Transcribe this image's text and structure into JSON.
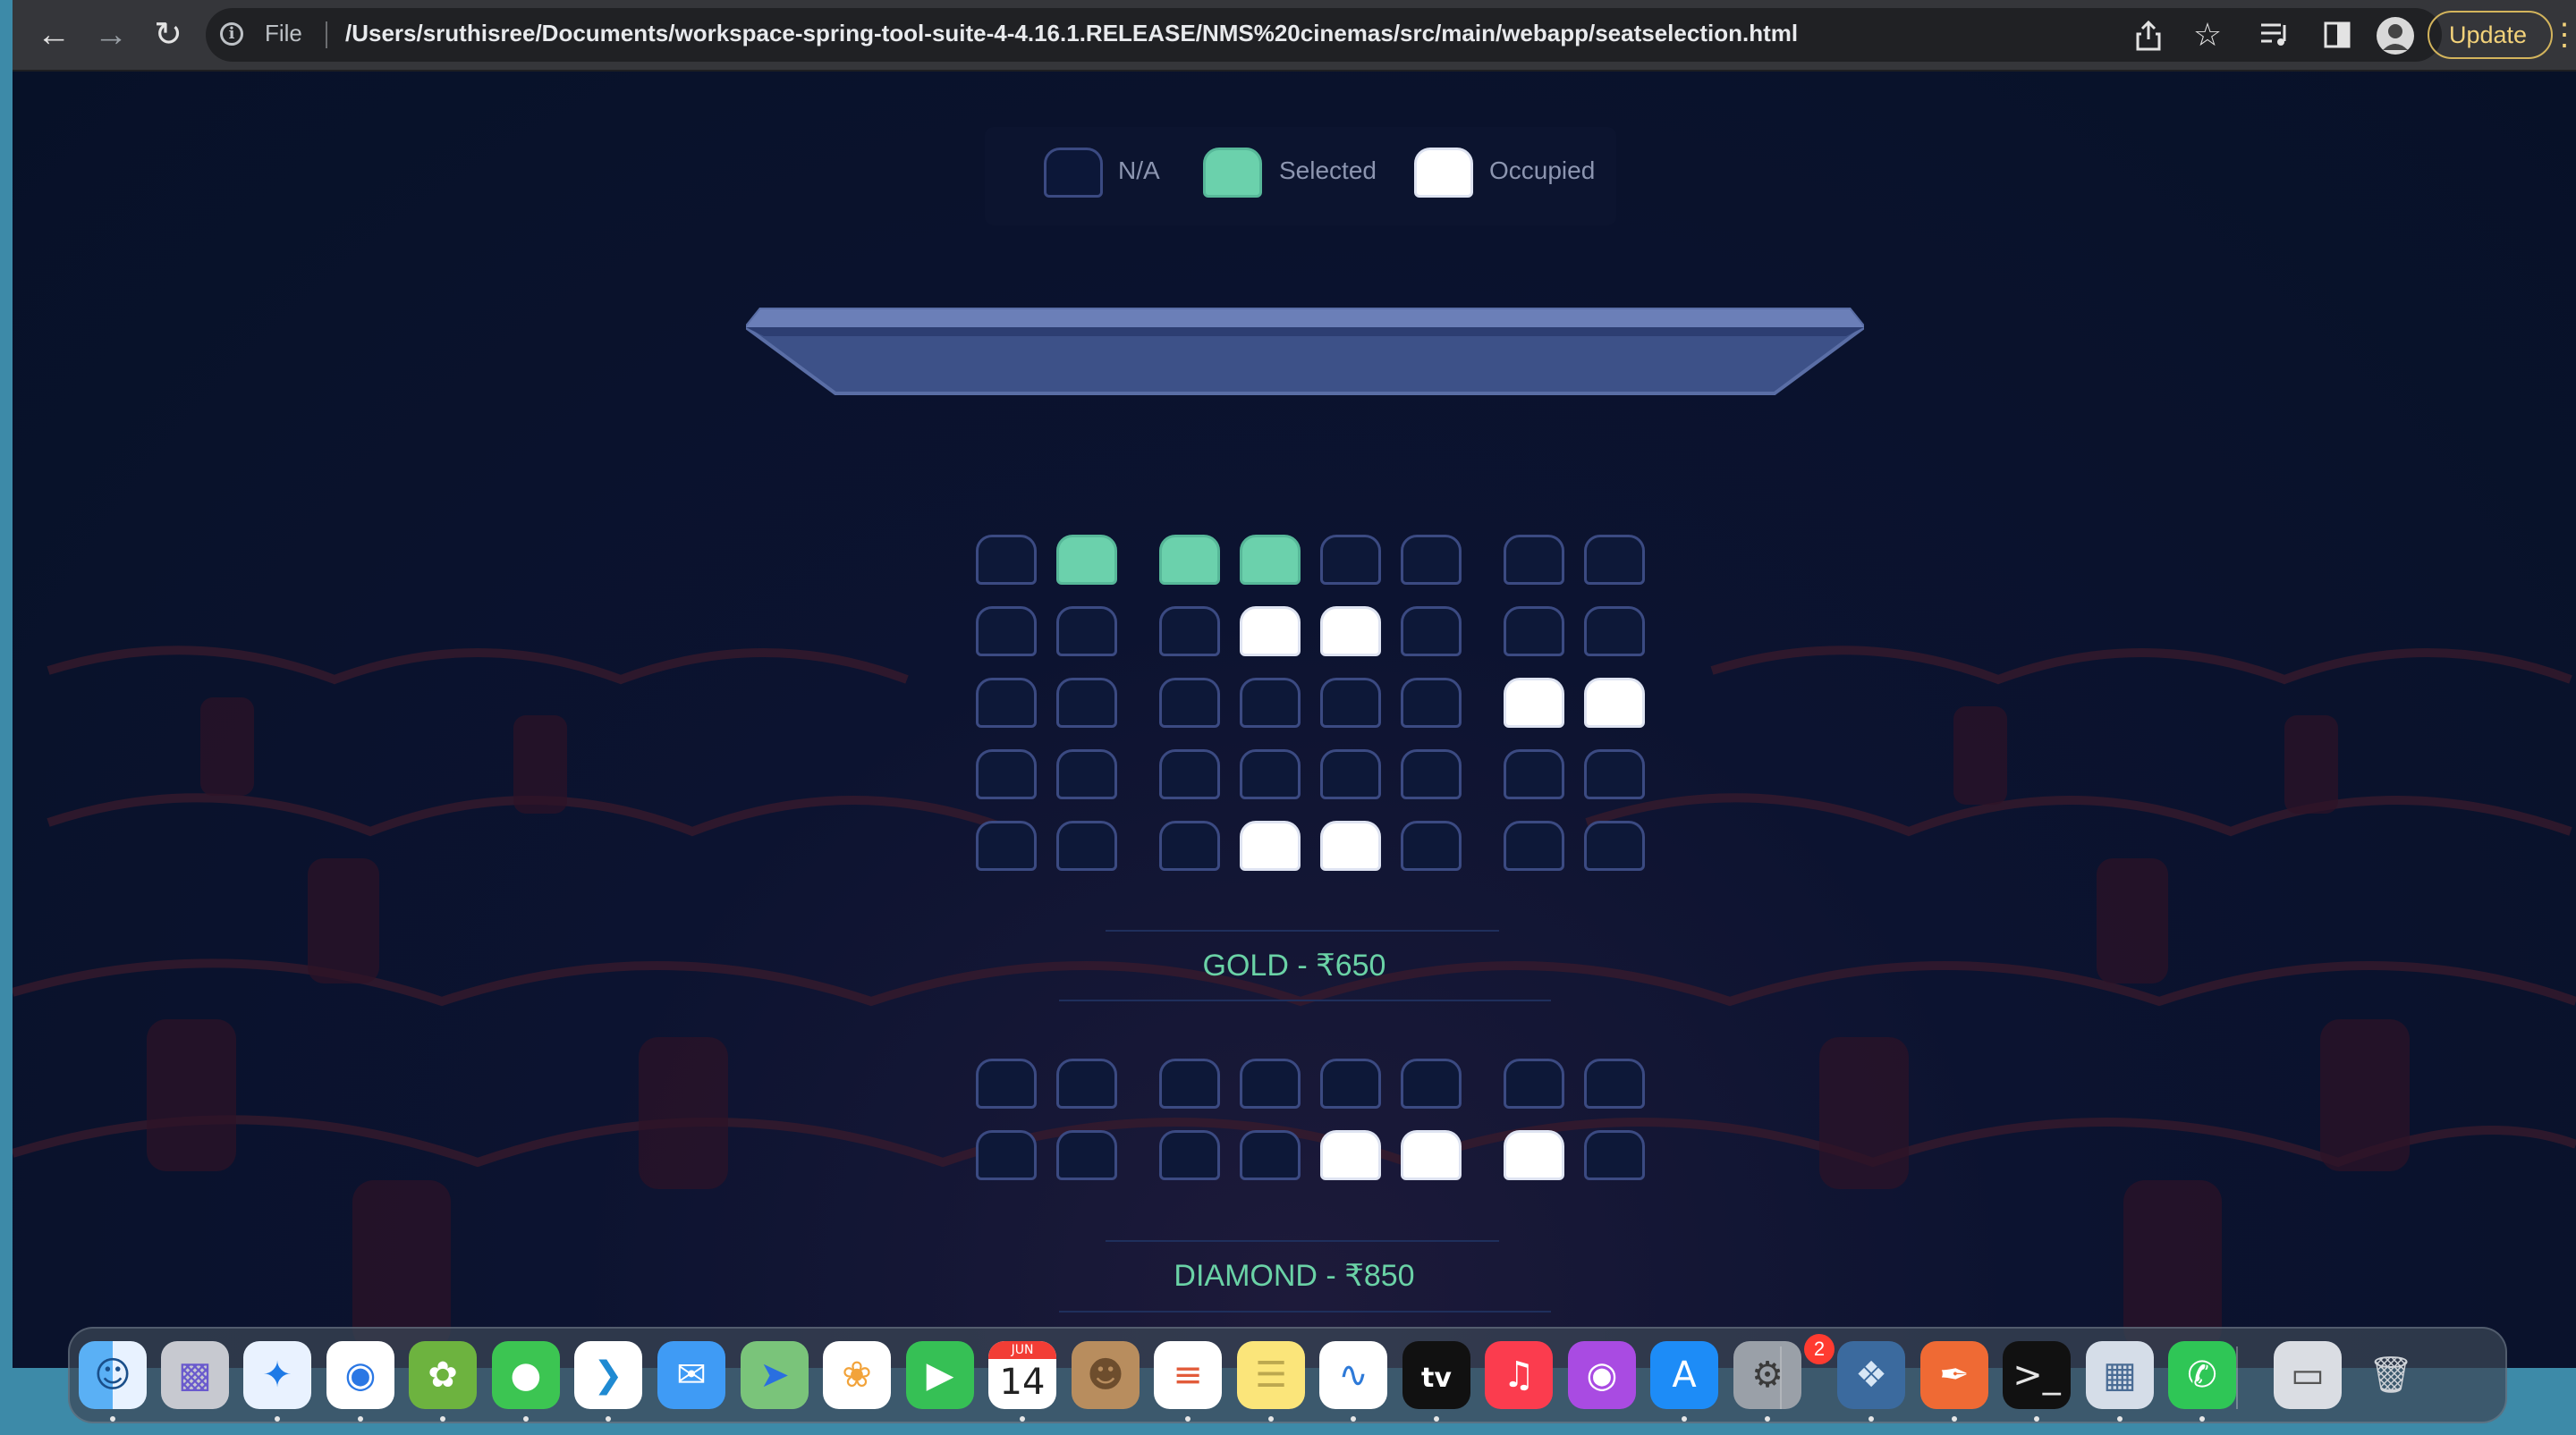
{
  "browser": {
    "scheme_label": "File",
    "url": "/Users/sruthisree/Documents/workspace-spring-tool-suite-4-4.16.1.RELEASE/NMS%20cinemas/src/main/webapp/seatselection.html",
    "update_label": "Update",
    "icons": [
      "back-arrow-icon",
      "forward-arrow-icon",
      "reload-icon",
      "info-icon",
      "share-icon",
      "bookmark-star-icon",
      "reading-list-icon",
      "side-panel-icon",
      "profile-avatar-icon",
      "more-menu-icon"
    ]
  },
  "legend": {
    "items": [
      {
        "label": "N/A",
        "state": "na"
      },
      {
        "label": "Selected",
        "state": "selected"
      },
      {
        "label": "Occupied",
        "state": "occupied"
      }
    ]
  },
  "colors": {
    "selected": "#6bd1ac",
    "occupied": "#ffffff",
    "na_border": "#3b4a82",
    "tier_label": "#6ad2a6",
    "background": "#071128"
  },
  "tiers": [
    {
      "label": "GOLD - ₹650",
      "rows": [
        [
          "na",
          "selected",
          "selected",
          "selected",
          "na",
          "na",
          "na",
          "na"
        ],
        [
          "na",
          "na",
          "na",
          "occupied",
          "occupied",
          "na",
          "na",
          "na"
        ],
        [
          "na",
          "na",
          "na",
          "na",
          "na",
          "na",
          "occupied",
          "occupied"
        ],
        [
          "na",
          "na",
          "na",
          "na",
          "na",
          "na",
          "na",
          "na"
        ],
        [
          "na",
          "na",
          "na",
          "occupied",
          "occupied",
          "na",
          "na",
          "na"
        ]
      ]
    },
    {
      "label": "DIAMOND - ₹850",
      "rows": [
        [
          "na",
          "na",
          "na",
          "na",
          "na",
          "na",
          "na",
          "na"
        ],
        [
          "na",
          "na",
          "na",
          "na",
          "occupied",
          "occupied",
          "occupied",
          "na"
        ]
      ]
    }
  ],
  "dock": {
    "apps": [
      "Finder",
      "Launchpad",
      "Safari",
      "Chrome",
      "Spring Tool Suite",
      "Messages",
      "Visual Studio Code",
      "Mail",
      "Maps",
      "Photos",
      "FaceTime",
      "Calendar",
      "Contacts",
      "Reminders",
      "Notes",
      "Freeform",
      "TV",
      "Music",
      "Podcasts",
      "App Store",
      "System Settings",
      "MySQL Workbench",
      "Postman",
      "Terminal",
      "Preview",
      "WhatsApp",
      "Screenshot",
      "Trash"
    ],
    "calendar_month": "JUN",
    "calendar_day": "14",
    "tv_label": "tv",
    "settings_badge": "2"
  }
}
